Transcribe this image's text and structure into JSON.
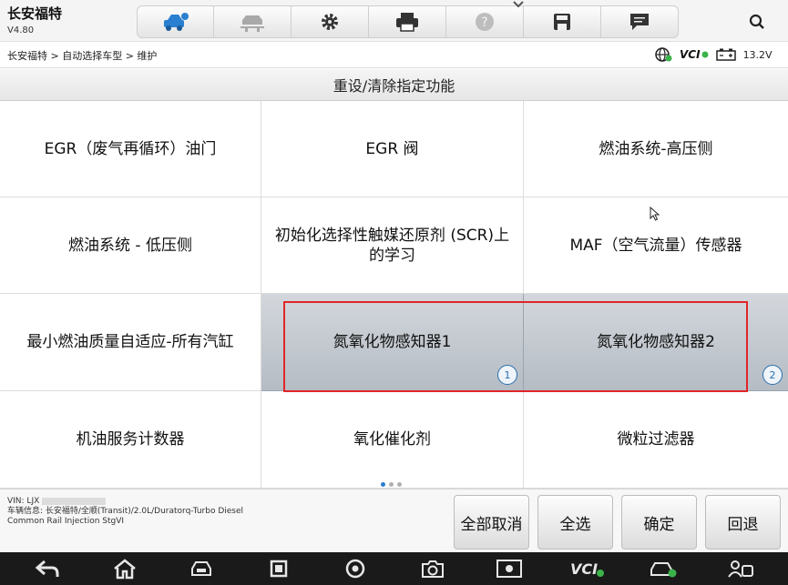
{
  "header": {
    "brand": "长安福特",
    "version": "V4.80",
    "toolbar": [
      {
        "name": "home-car-icon"
      },
      {
        "name": "vehicle-lift-icon"
      },
      {
        "name": "settings-gear-icon"
      },
      {
        "name": "printer-icon"
      },
      {
        "name": "help-icon"
      },
      {
        "name": "save-icon"
      },
      {
        "name": "message-icon"
      }
    ],
    "search_icon": "search-icon"
  },
  "breadcrumb": "长安福特 > 自动选择车型 > 维护",
  "status": {
    "vci_label": "VCI",
    "voltage": "13.2V"
  },
  "page_title": "重设/清除指定功能",
  "functions": [
    {
      "label": "EGR（废气再循环）油门"
    },
    {
      "label": "EGR 阀"
    },
    {
      "label": "燃油系统-高压侧"
    },
    {
      "label": "燃油系统 - 低压侧"
    },
    {
      "label": "初始化选择性触媒还原剂 (SCR)上的学习"
    },
    {
      "label": "MAF（空气流量）传感器"
    },
    {
      "label": "最小燃油质量自适应-所有汽缸"
    },
    {
      "label": "氮氧化物感知器1",
      "selected": true,
      "badge": "1"
    },
    {
      "label": "氮氧化物感知器2",
      "selected": true,
      "badge": "2"
    },
    {
      "label": "机油服务计数器"
    },
    {
      "label": "氧化催化剂"
    },
    {
      "label": "微粒过滤器"
    }
  ],
  "vehicle": {
    "vin_label": "VIN: LJX",
    "info_line1": "车辆信息: 长安福特/全顺(Transit)/2.0L/Duratorq-Turbo Diesel",
    "info_line2": "Common Rail Injection StgVI"
  },
  "footer_buttons": {
    "cancel_all": "全部取消",
    "select_all": "全选",
    "confirm": "确定",
    "back": "回退"
  },
  "colors": {
    "highlight": "#e0262a",
    "badge": "#2a6fb0",
    "selected_cell": "#c4cad1"
  }
}
